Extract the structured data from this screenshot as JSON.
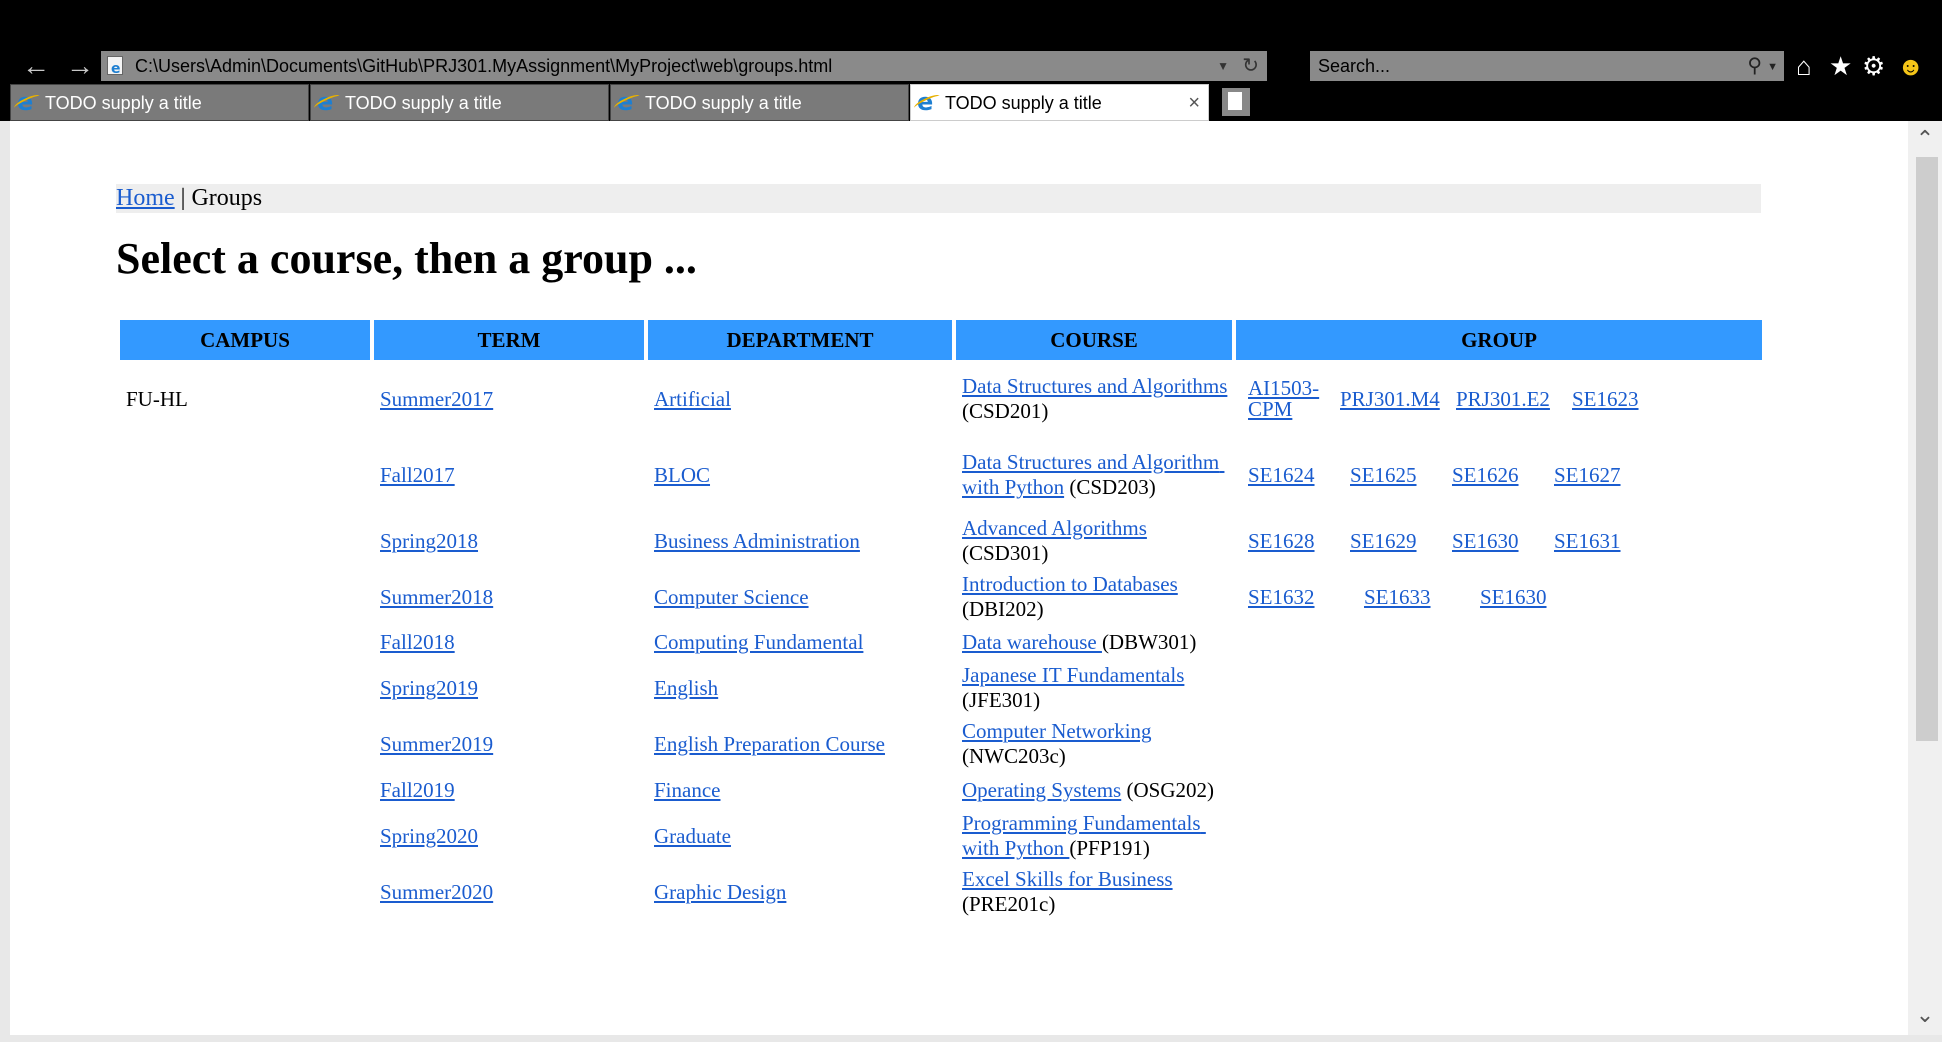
{
  "browser": {
    "address": "C:\\Users\\Admin\\Documents\\GitHub\\PRJ301.MyAssignment\\MyProject\\web\\groups.html",
    "search_placeholder": "Search...",
    "tabs": [
      {
        "title": "TODO supply a title"
      },
      {
        "title": "TODO supply a title"
      },
      {
        "title": "TODO supply a title"
      },
      {
        "title": "TODO supply a title"
      }
    ]
  },
  "page": {
    "breadcrumb": {
      "home": "Home",
      "separator": " | ",
      "current": "Groups"
    },
    "title": "Select a course, then a group ...",
    "table_headers": [
      "CAMPUS",
      "TERM",
      "DEPARTMENT",
      "COURSE",
      "GROUP"
    ],
    "campus": "FU-HL",
    "rows": [
      {
        "term": "Summer2017",
        "department": "Artificial",
        "course": "Data Structures and Algorithms",
        "code": " (CSD201)",
        "groups": [
          "AI1503-CPM",
          "PRJ301.M4",
          "PRJ301.E2",
          "SE1623"
        ]
      },
      {
        "term": "Fall2017",
        "department": "BLOC",
        "course": "Data Structures and Algorithm with Python",
        "code": " (CSD203)",
        "groups": [
          "SE1624",
          "SE1625",
          "SE1626",
          "SE1627"
        ]
      },
      {
        "term": "Spring2018",
        "department": "Business Administration",
        "course": "Advanced Algorithms",
        "code": " (CSD301)",
        "groups": [
          "SE1628",
          "SE1629",
          "SE1630",
          "SE1631"
        ]
      },
      {
        "term": "Summer2018",
        "department": "Computer Science",
        "course": "Introduction to Databases",
        "code": " (DBI202)",
        "groups": [
          "SE1632",
          "SE1633",
          "SE1630"
        ]
      },
      {
        "term": "Fall2018",
        "department": "Computing Fundamental",
        "course": "Data warehouse ",
        "code": "(DBW301)",
        "groups": []
      },
      {
        "term": "Spring2019",
        "department": "English",
        "course": "Japanese IT Fundamentals",
        "code": " (JFE301)",
        "groups": []
      },
      {
        "term": "Summer2019",
        "department": "English Preparation Course",
        "course": "Computer Networking",
        "code": " (NWC203c)",
        "groups": []
      },
      {
        "term": "Fall2019",
        "department": "Finance",
        "course": "Operating Systems",
        "code": " (OSG202)",
        "groups": []
      },
      {
        "term": "Spring2020",
        "department": "Graduate",
        "course": "Programming Fundamentals with Python ",
        "code": "(PFP191)",
        "groups": []
      },
      {
        "term": "Summer2020",
        "department": "Graphic Design",
        "course": "Excel Skills for Business",
        "code": " (PRE201c)",
        "groups": []
      }
    ]
  },
  "colors": {
    "header_bg": "#3399ff",
    "link": "#1a5ccf",
    "breadcrumb_bg": "#eeeeee"
  },
  "icons": [
    "back-arrow-icon",
    "forward-arrow-icon",
    "refresh-icon",
    "search-icon",
    "home-icon",
    "favorites-star-icon",
    "settings-gear-icon",
    "smiley-feedback-icon",
    "ie-logo-icon",
    "close-icon",
    "new-tab-icon"
  ]
}
